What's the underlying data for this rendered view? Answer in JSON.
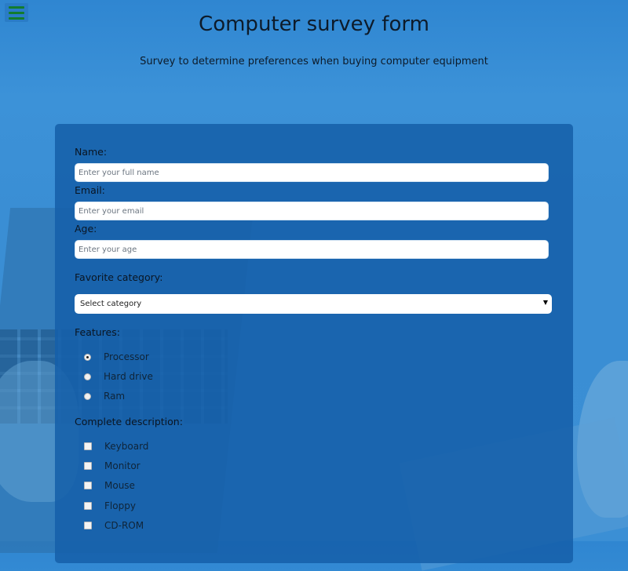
{
  "header": {
    "menu_icon": "hamburger-menu-icon",
    "title": "Computer survey form",
    "description": "Survey to determine preferences when buying computer equipment"
  },
  "form": {
    "name": {
      "label": "Name:",
      "placeholder": "Enter your full name"
    },
    "email": {
      "label": "Email:",
      "placeholder": "Enter your email"
    },
    "age": {
      "label": "Age:",
      "placeholder": "Enter your age"
    },
    "category": {
      "label": "Favorite category:",
      "selected": "Select category"
    },
    "features": {
      "label": "Features:",
      "options": [
        "Processor",
        "Hard drive",
        "Ram"
      ],
      "selected": "Processor"
    },
    "description": {
      "label": "Complete description:",
      "options": [
        "Keyboard",
        "Monitor",
        "Mouse",
        "Floppy",
        "CD-ROM"
      ]
    }
  },
  "colors": {
    "background": "#3b8fd5",
    "card": "#1660aa",
    "menu_icon": "#127c2e"
  }
}
